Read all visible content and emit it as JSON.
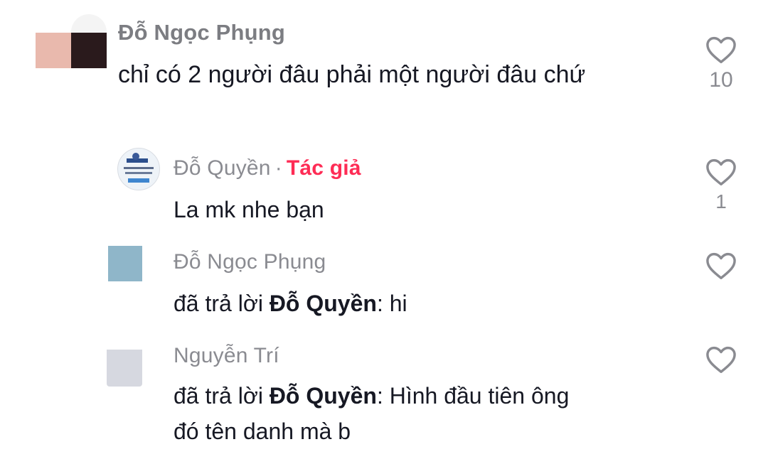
{
  "comments": [
    {
      "username": "Đỗ Ngọc Phụng",
      "text": "chỉ có 2 người đâu phải một người đâu chứ",
      "like_count": "10",
      "avatar_colors": [
        "#e9b9ad",
        "#2a1a1c"
      ]
    },
    {
      "username": "Đỗ Quyền",
      "separator": "·",
      "author_tag": "Tác giả",
      "text": "La mk nhe bạn",
      "like_count": "1"
    },
    {
      "username": "Đỗ Ngọc Phụng",
      "reply_prefix": "đã trả lời",
      "reply_target": "Đỗ Quyền",
      "reply_suffix": ": hi",
      "avatar_color": "#8fb6c9"
    },
    {
      "username": "Nguyễn Trí",
      "reply_prefix": "đã trả lời",
      "reply_target": "Đỗ Quyền",
      "reply_suffix": ": Hình đầu tiên ông",
      "reply_line2": "đó tên danh mà b",
      "avatar_color": "#d6d8e0"
    }
  ],
  "icons": {
    "like": "heart-outline-icon"
  }
}
